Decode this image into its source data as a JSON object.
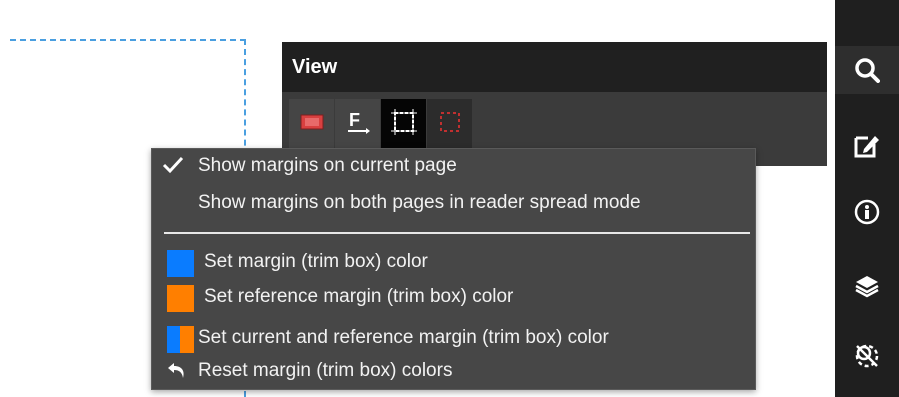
{
  "view_panel": {
    "title": "View",
    "tools": [
      {
        "icon": "page-frame-icon"
      },
      {
        "icon": "text-format-icon"
      },
      {
        "icon": "trim-box-icon",
        "selected": true
      },
      {
        "icon": "margin-outline-icon"
      }
    ]
  },
  "menu": {
    "show_current": "Show margins on current page",
    "show_current_checked": true,
    "show_both": "Show margins on both pages in reader spread mode",
    "set_margin_color": "Set margin (trim box) color",
    "set_reference_color": "Set reference margin (trim box) color",
    "set_both_color": "Set current and reference margin (trim box) color",
    "reset_colors": "Reset margin (trim box) colors"
  },
  "colors": {
    "margin": "#0a7cff",
    "reference": "#ff7f00",
    "guide": "#4a9fe0"
  },
  "right_toolbar": {
    "icons": [
      "search-icon",
      "edit-icon",
      "info-icon",
      "layers-icon",
      "mask-icon"
    ],
    "active": "search-icon"
  }
}
